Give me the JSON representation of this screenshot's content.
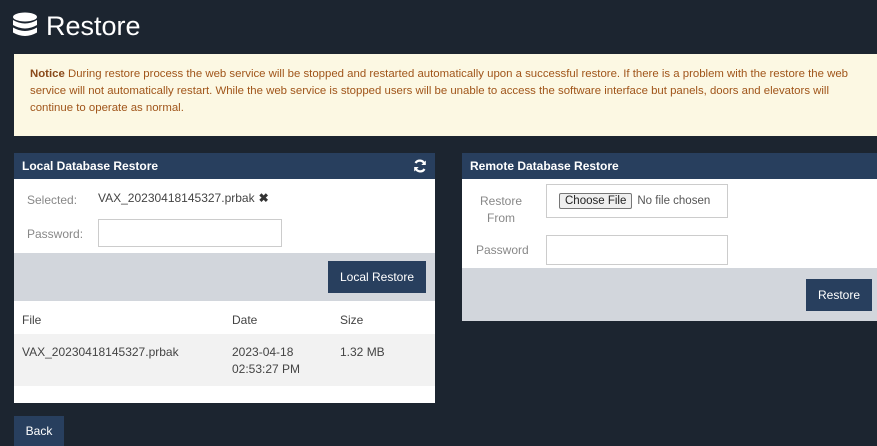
{
  "header": {
    "title": "Restore",
    "icon": "database-icon"
  },
  "notice": {
    "label": "Notice",
    "text": " During restore process the web service will be stopped and restarted automatically upon a successful restore. If there is a problem with the restore the web service will not automatically restart. While the web service is stopped users will be unable to access the software interface but panels, doors and elevators will continue to operate as normal."
  },
  "local": {
    "title": "Local Database Restore",
    "selected_label": "Selected:",
    "selected_value": "VAX_20230418145327.prbak",
    "password_label": "Password:",
    "password_value": "",
    "restore_button": "Local Restore",
    "table": {
      "headers": [
        "File",
        "Date",
        "Size"
      ],
      "rows": [
        {
          "file": "VAX_20230418145327.prbak",
          "date": "2023-04-18 02:53:27 PM",
          "size": "1.32 MB"
        }
      ]
    }
  },
  "remote": {
    "title": "Remote Database Restore",
    "restore_from_label": "Restore From",
    "choose_file_button": "Choose File",
    "no_file_text": "No file chosen",
    "password_label": "Password",
    "password_value": "",
    "restore_button": "Restore"
  },
  "footer": {
    "back_button": "Back"
  },
  "colors": {
    "background": "#1c2530",
    "panel_header": "#283f5e",
    "notice_bg": "#fcf8e3",
    "notice_text": "#a0551a",
    "button_bar": "#d2d6dc"
  }
}
